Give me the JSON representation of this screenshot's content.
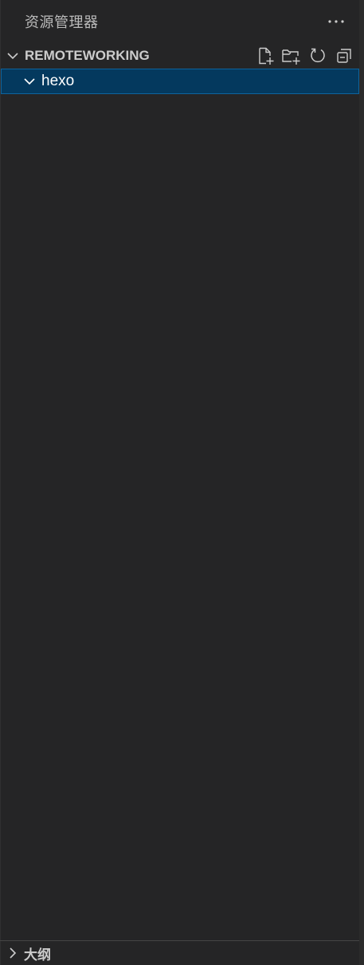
{
  "title_bar": {
    "title": "资源管理器",
    "more_icon": "more-ellipsis-icon"
  },
  "workspace": {
    "name": "REMOTEWORKING",
    "expanded": true,
    "actions": [
      {
        "name": "new-file-button",
        "icon": "new-file-icon"
      },
      {
        "name": "new-folder-button",
        "icon": "new-folder-icon"
      },
      {
        "name": "refresh-button",
        "icon": "refresh-icon"
      },
      {
        "name": "collapse-all-button",
        "icon": "collapse-all-icon"
      }
    ]
  },
  "tree": {
    "items": [
      {
        "label": "hexo",
        "type": "folder",
        "expanded": true,
        "selected": true
      }
    ]
  },
  "outline": {
    "title": "大纲",
    "expanded": false
  },
  "colors": {
    "background": "#252526",
    "selection": "#04395e",
    "selection_border": "#0e639c",
    "text": "#cccccc"
  }
}
